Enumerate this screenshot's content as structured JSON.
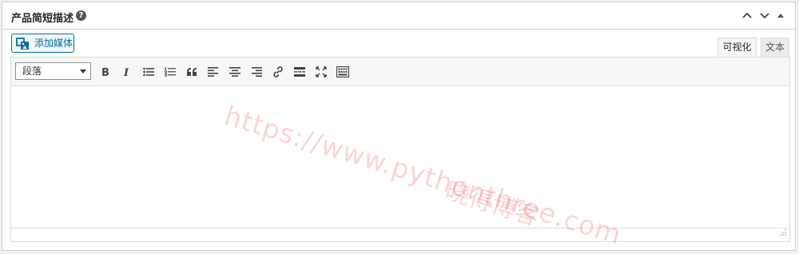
{
  "metabox": {
    "title": "产品简短描述",
    "help_glyph": "?"
  },
  "toolbar_top": {
    "add_media_label": "添加媒体"
  },
  "tabs": [
    {
      "label": "可视化",
      "active": true
    },
    {
      "label": "文本",
      "active": false
    }
  ],
  "editor": {
    "format_selected": "段落",
    "content": ""
  },
  "watermark": {
    "url": "https://www.pythonthree.com",
    "name": "晓得博客"
  },
  "colors": {
    "accent": "#0071a1",
    "border": "#ccd0d4",
    "toolbar_bg": "#f6f7f7",
    "watermark": "#e63c3c"
  }
}
